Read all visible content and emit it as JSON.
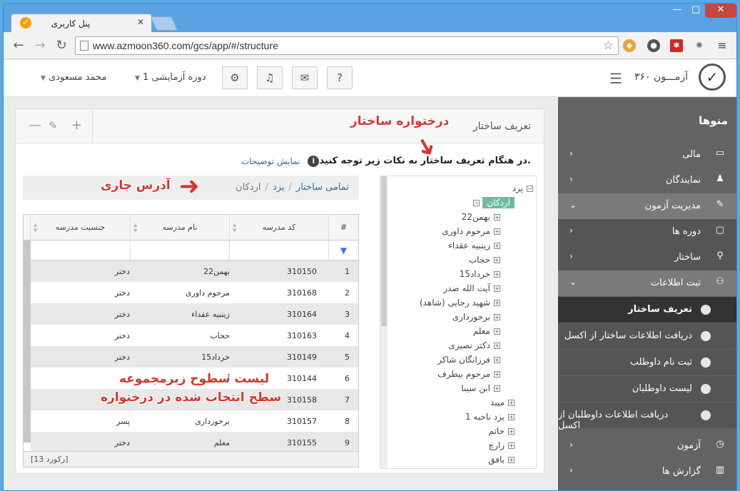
{
  "browser": {
    "tab_title": "پنل کاربری",
    "url": "www.azmoon360.com/gcs/app/#/structure",
    "win_min": "—",
    "win_max": "□",
    "win_close": "✕",
    "tab_close": "✕"
  },
  "header": {
    "logo_text": "آزمـــون ۳۶۰",
    "period_label": "دوره آزمایشی 1",
    "user_label": "محمد مسعودی",
    "help": "?"
  },
  "sidebar": {
    "title": "منوها",
    "items": [
      {
        "label": "مالی"
      },
      {
        "label": "نمایندگان"
      },
      {
        "label": "مدیریت آزمون"
      },
      {
        "label": "دوره ها"
      },
      {
        "label": "ساختار"
      },
      {
        "label": "ثبت اطلاعات"
      },
      {
        "label": "تعریف ساختار"
      },
      {
        "label": "دریافت اطلاعات ساختار از اکسل"
      },
      {
        "label": "ثبت نام داوطلب"
      },
      {
        "label": "لیست داوطلبان"
      },
      {
        "label": "دریافت اطلاعات داوطلبان از اکسل"
      },
      {
        "label": "آزمون"
      },
      {
        "label": "گزارش ها"
      }
    ]
  },
  "main": {
    "title": "تعریف ساختار",
    "info_text": "در هنگام تعریف ساختار به نکات زیر توجه کنید.",
    "info_link": "نمایش توضیحات",
    "breadcrumb": [
      "تمامی ساختار",
      "یزد",
      "اردکان"
    ]
  },
  "tree": {
    "root": "یزد",
    "selected": "اردکان",
    "children": [
      "22بهمن",
      "مرحوم داوری",
      "زینبیه عقداء",
      "حجاب",
      "15خرداد",
      "آیت الله صدر",
      "شهید رجایی (شاهد)",
      "برخورداری",
      "معلم",
      "دکتر نصیری",
      "فرزانگان شاکر",
      "مرحوم بیطرف",
      "ابن سینا"
    ],
    "siblings": [
      "میبد",
      "یزد ناحیه 1",
      "خاتم",
      "زارچ",
      "بافق"
    ]
  },
  "grid": {
    "headers": {
      "num": "#",
      "code": "کد مدرسه",
      "name": "نام مدرسه",
      "gender": "جنسیت مدرسه"
    },
    "rows": [
      {
        "n": "1",
        "code": "310150",
        "name": "22بهمن",
        "gender": "دختر"
      },
      {
        "n": "2",
        "code": "310168",
        "name": "مرحوم داوری",
        "gender": "دختر"
      },
      {
        "n": "3",
        "code": "310164",
        "name": "زینبیه عقداء",
        "gender": "دختر"
      },
      {
        "n": "4",
        "code": "310163",
        "name": "حجاب",
        "gender": "دختر"
      },
      {
        "n": "5",
        "code": "310149",
        "name": "15خرداد",
        "gender": "دختر"
      },
      {
        "n": "6",
        "code": "310144",
        "name": "آ",
        "gender": "د"
      },
      {
        "n": "7",
        "code": "310158",
        "name": "",
        "gender": ""
      },
      {
        "n": "8",
        "code": "310157",
        "name": "برخورداری",
        "gender": "پسر"
      },
      {
        "n": "9",
        "code": "310155",
        "name": "معلم",
        "gender": "دختر"
      }
    ],
    "footer": "[13 رکورد]"
  },
  "annotations": {
    "tree": "درختواره ساختار",
    "address": "آدرس جاری",
    "list_line1": "لیست سطوح زیرمجموعه",
    "list_line2": "سطح انتخاب شده در درختواره"
  }
}
